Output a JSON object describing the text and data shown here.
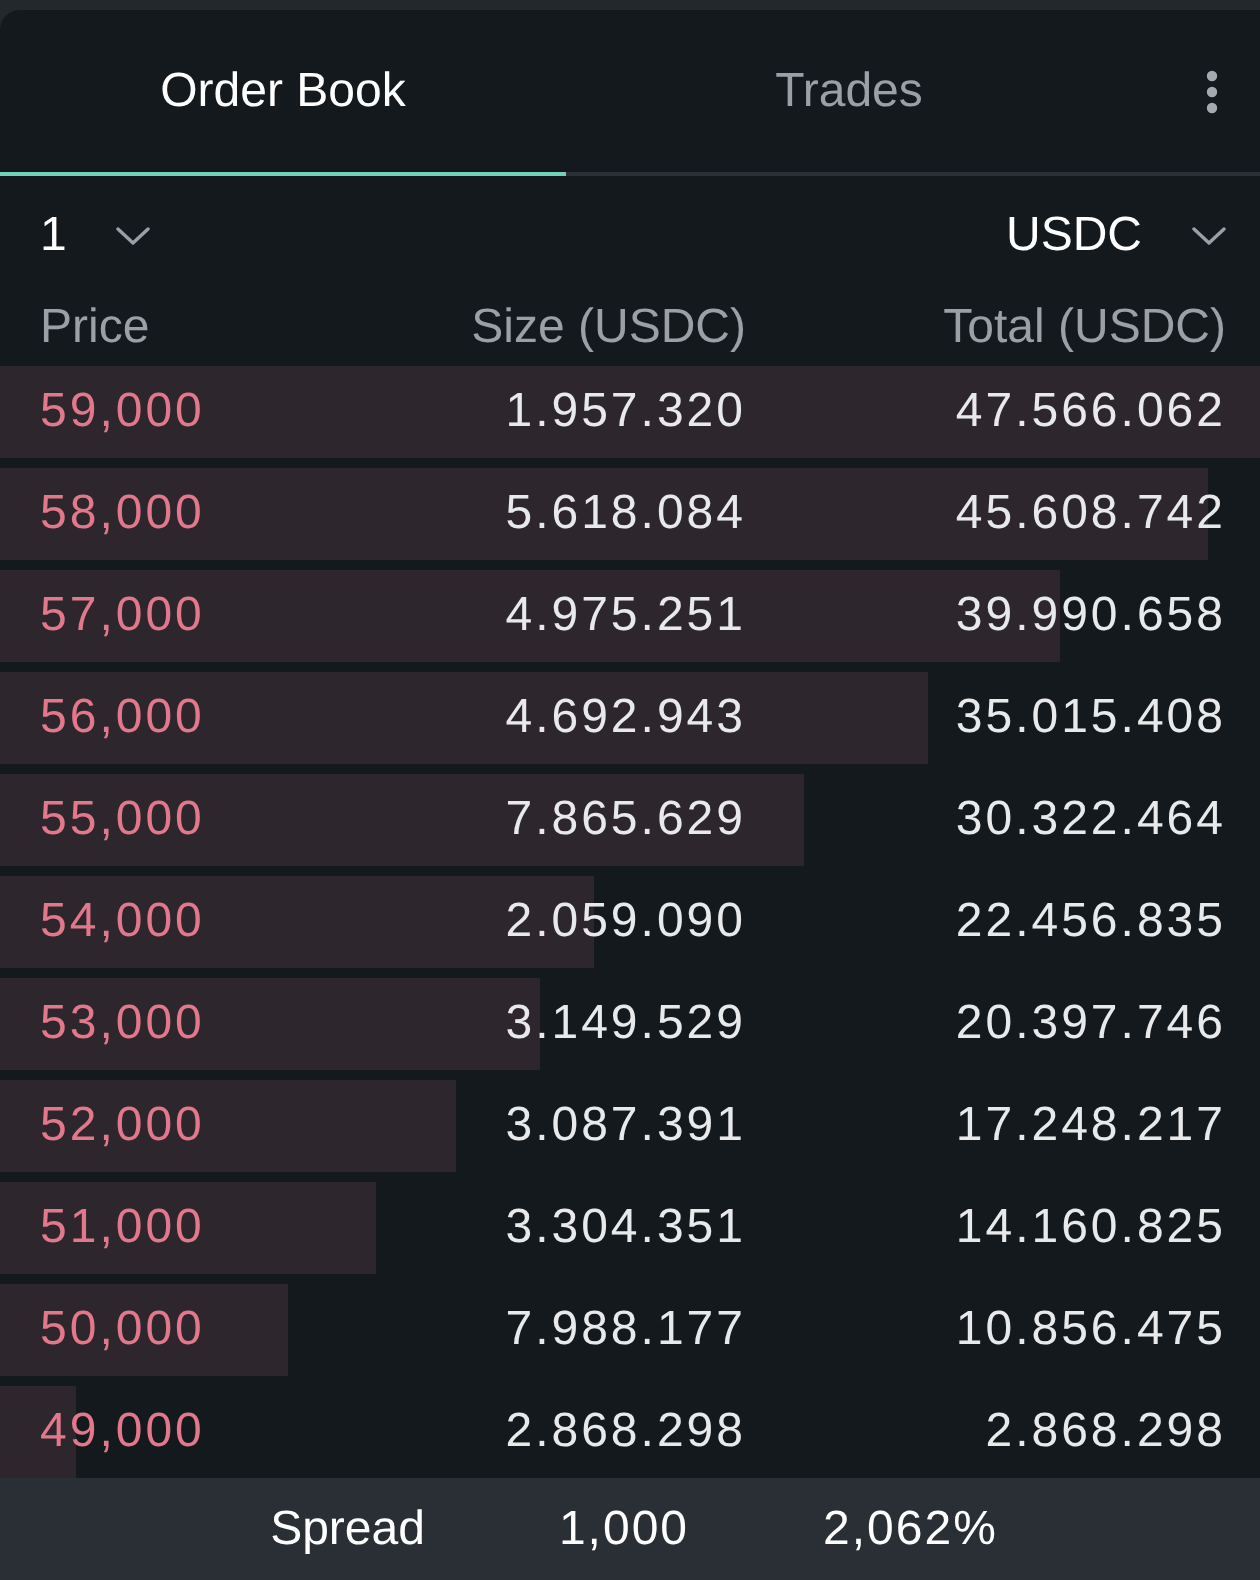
{
  "tabs": [
    {
      "label": "Order Book",
      "selected": true
    },
    {
      "label": "Trades",
      "selected": false
    }
  ],
  "grouping_dropdown": {
    "value": "1"
  },
  "currency_dropdown": {
    "value": "USDC"
  },
  "columns": [
    "Price",
    "Size (USDC)",
    "Total (USDC)"
  ],
  "rows": [
    {
      "kind": "ask",
      "price": "59,000",
      "size": "1.957.320",
      "total": "47.566.062",
      "level": 1
    },
    {
      "kind": "ask",
      "price": "58,000",
      "size": "5.618.084",
      "total": "45.608.742",
      "level": 0.959
    },
    {
      "kind": "ask",
      "price": "57,000",
      "size": "4.975.251",
      "total": "39.990.658",
      "level": 0.841
    },
    {
      "kind": "ask",
      "price": "56,000",
      "size": "4.692.943",
      "total": "35.015.408",
      "level": 0.736
    },
    {
      "kind": "ask",
      "price": "55,000",
      "size": "7.865.629",
      "total": "30.322.464",
      "level": 0.6375
    },
    {
      "kind": "ask",
      "price": "54,000",
      "size": "2.059.090",
      "total": "22.456.835",
      "level": 0.472
    },
    {
      "kind": "ask",
      "price": "53,000",
      "size": "3.149.529",
      "total": "20.397.746",
      "level": 0.429
    },
    {
      "kind": "ask",
      "price": "52,000",
      "size": "3.087.391",
      "total": "17.248.217",
      "level": 0.3626
    },
    {
      "kind": "ask",
      "price": "51,000",
      "size": "3.304.351",
      "total": "14.160.825",
      "level": 0.2977
    },
    {
      "kind": "ask",
      "price": "50,000",
      "size": "7.988.177",
      "total": "10.856.475",
      "level": 0.2282
    },
    {
      "kind": "ask",
      "price": "49,000",
      "size": "2.868.298",
      "total": "2.868.298",
      "level": 0.0603
    }
  ],
  "spread": {
    "label": "Spread",
    "value": "1,000",
    "percent": "2,062%"
  }
}
